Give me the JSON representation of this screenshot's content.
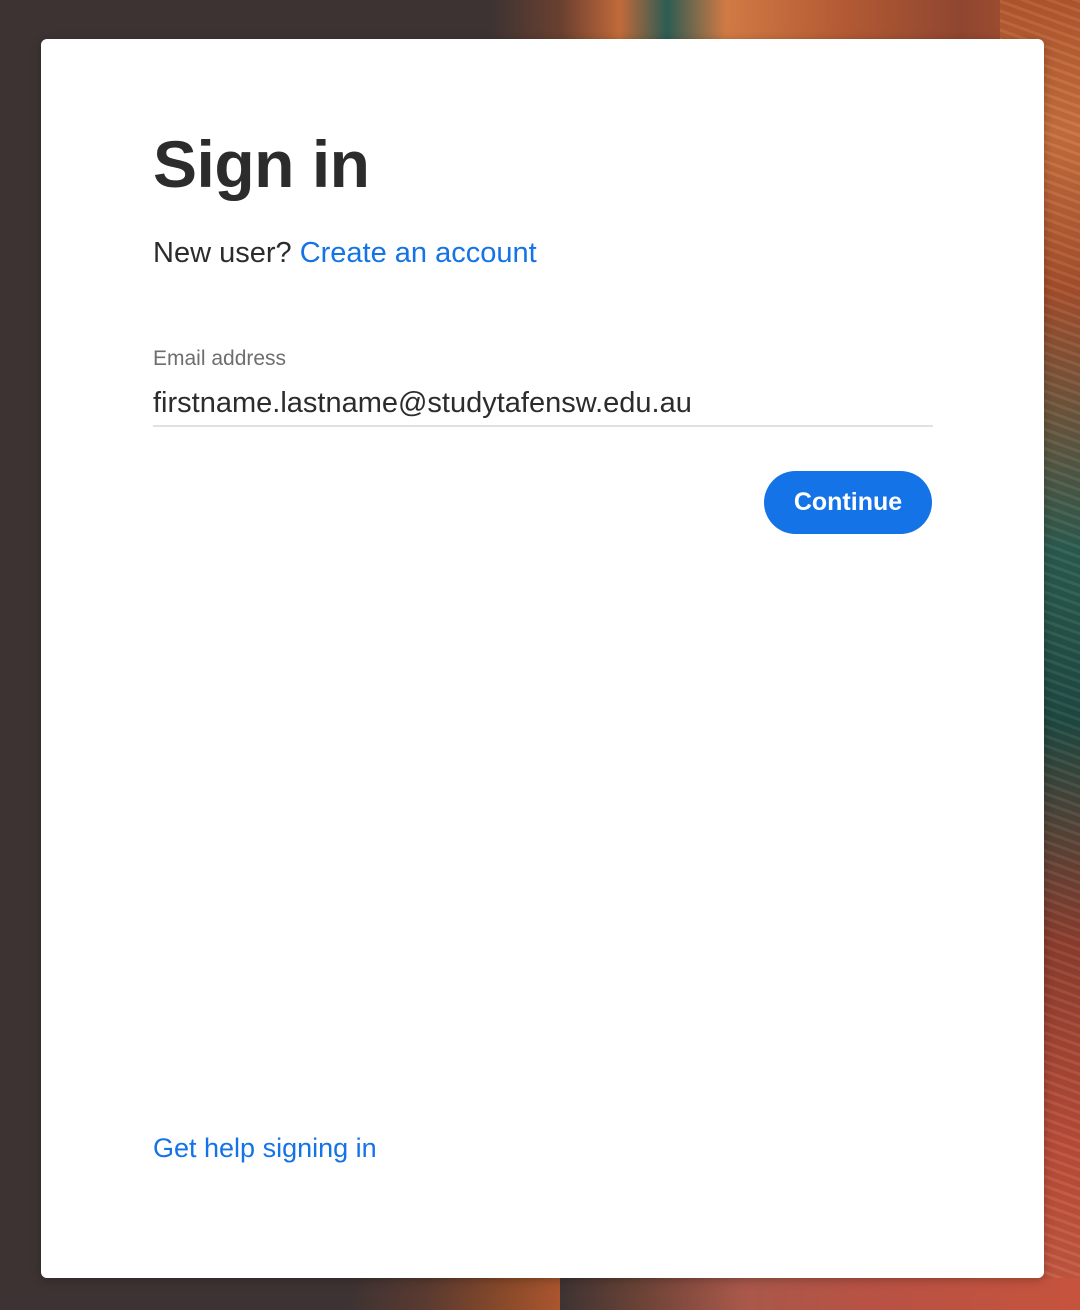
{
  "signin": {
    "title": "Sign in",
    "new_user_prompt": "New user?",
    "create_account_link": "Create an account",
    "email_label": "Email address",
    "email_value": "firstname.lastname@studytafensw.edu.au",
    "continue_label": "Continue",
    "help_link": "Get help signing in"
  },
  "colors": {
    "accent": "#1473e6",
    "text": "#2c2c2c",
    "label": "#6e6e6e",
    "card": "#ffffff",
    "backdrop": "#3d3333"
  }
}
